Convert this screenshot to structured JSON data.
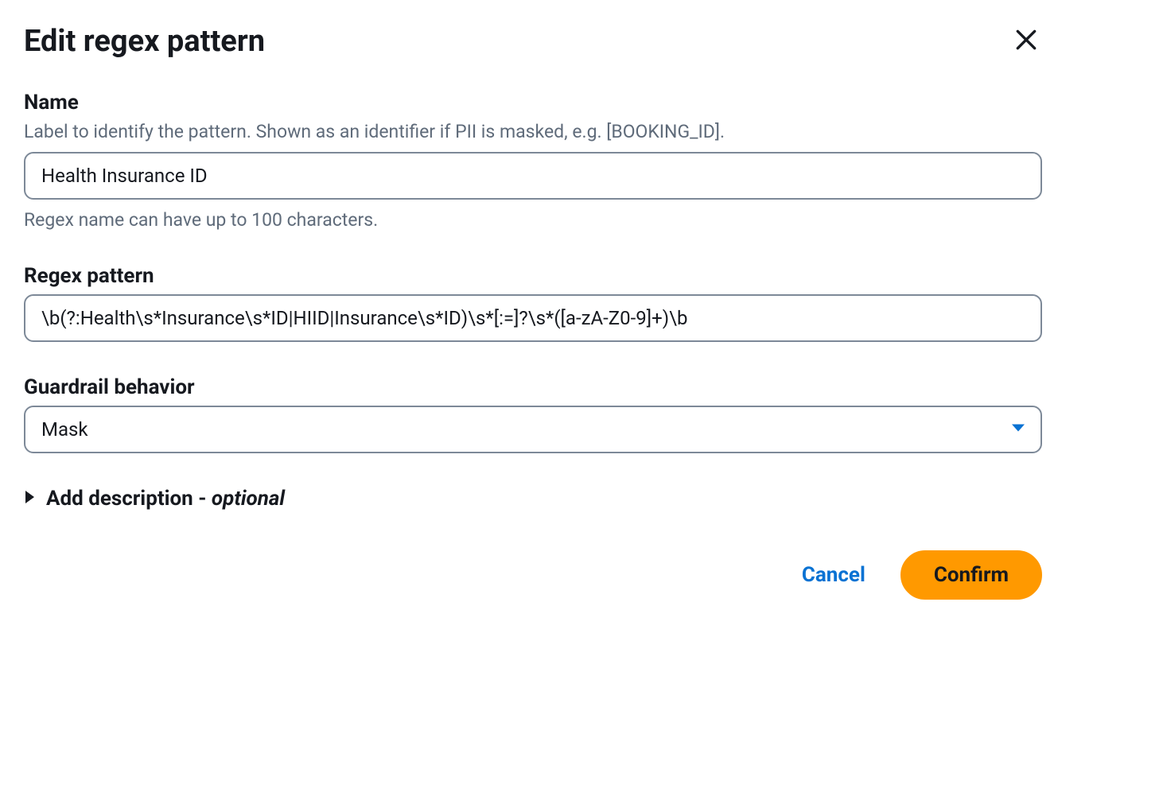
{
  "dialog": {
    "title": "Edit regex pattern"
  },
  "form": {
    "name": {
      "label": "Name",
      "description": "Label to identify the pattern. Shown as an identifier if PII is masked, e.g. [BOOKING_ID].",
      "value": "Health Insurance ID",
      "helper": "Regex name can have up to 100 characters."
    },
    "regex": {
      "label": "Regex pattern",
      "value": "\\b(?:Health\\s*Insurance\\s*ID|HIID|Insurance\\s*ID)\\s*[:=]?\\s*([a-zA-Z0-9]+)\\b"
    },
    "behavior": {
      "label": "Guardrail behavior",
      "value": "Mask"
    },
    "description_section": {
      "label": "Add description - ",
      "optional": "optional"
    }
  },
  "footer": {
    "cancel": "Cancel",
    "confirm": "Confirm"
  }
}
